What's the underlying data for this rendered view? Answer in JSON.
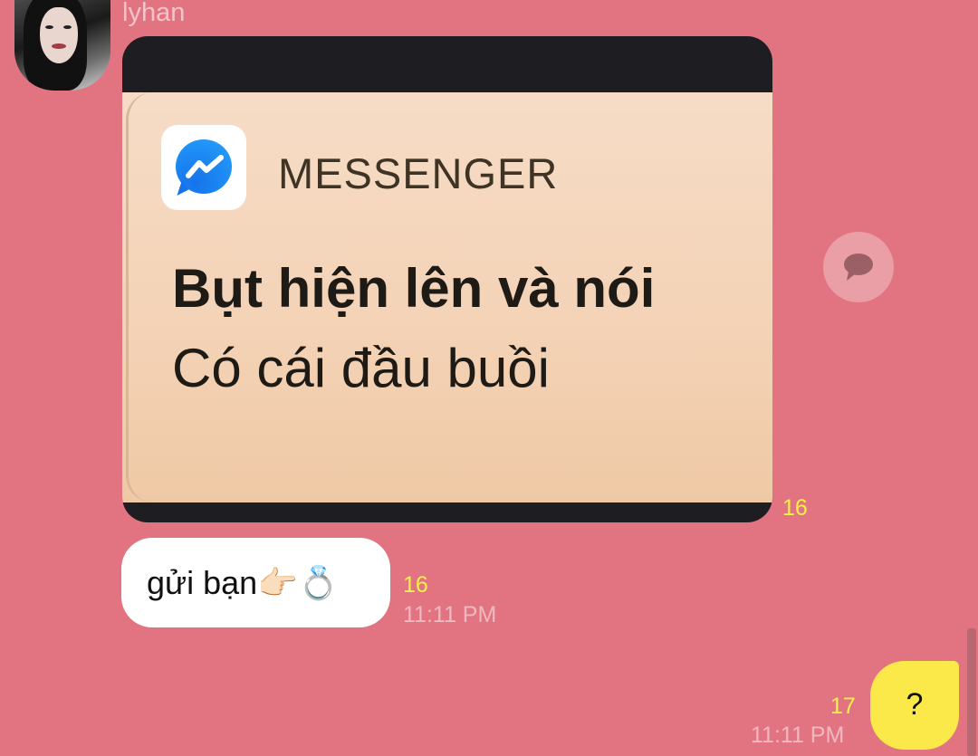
{
  "sender": {
    "name": "lyhan"
  },
  "image_message": {
    "app_name": "MESSENGER",
    "line1": "Bụt hiện lên và nói",
    "line2": "Có cái đầu buồi",
    "unread_count": "16"
  },
  "text_message": {
    "text": "gửi bạn👉🏻💍",
    "unread_count": "16",
    "time": "11:11 PM"
  },
  "my_message": {
    "text": "?",
    "unread_count": "17",
    "time": "11:11 PM"
  },
  "colors": {
    "background": "#e27380",
    "my_bubble": "#fbe94a",
    "unread_count": "#f8f24a"
  }
}
